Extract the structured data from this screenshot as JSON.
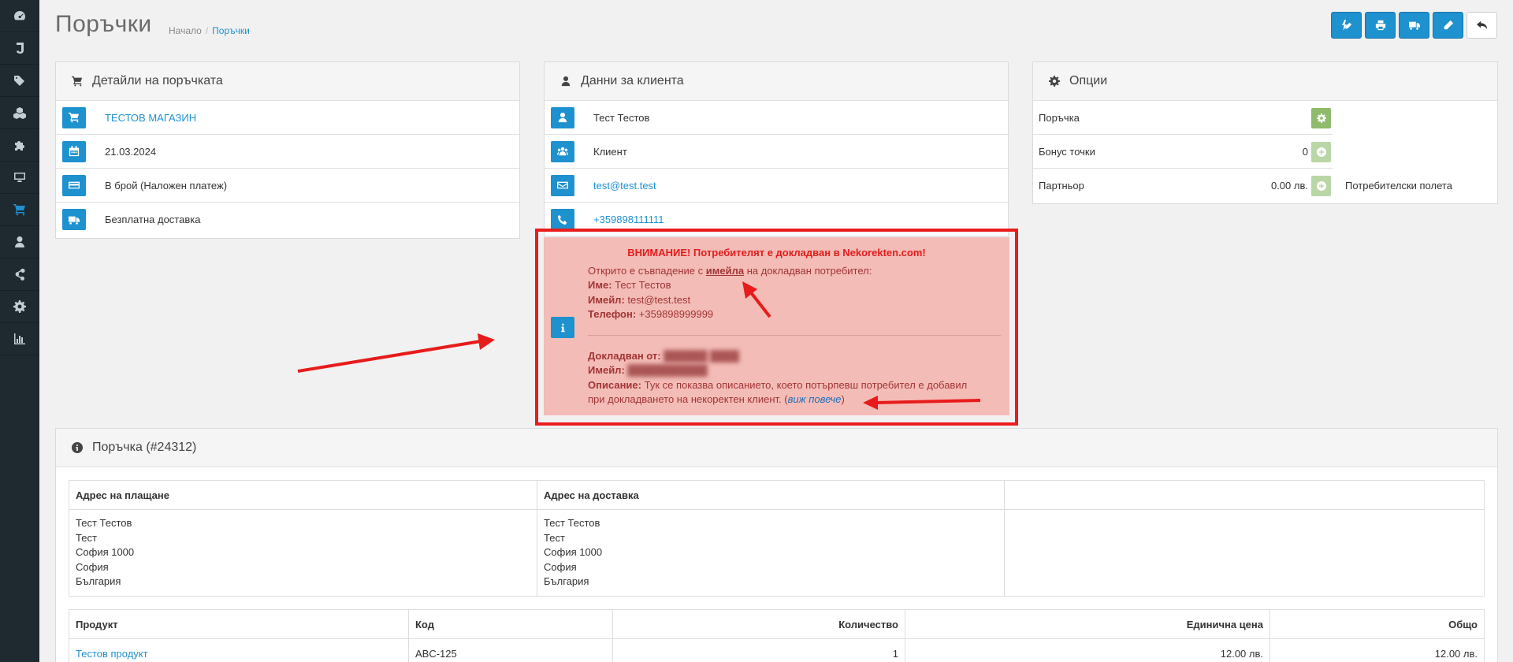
{
  "header": {
    "title": "Поръчки",
    "breadcrumb": [
      "Начало",
      "Поръчки"
    ]
  },
  "sidebar": {
    "items": [
      {
        "icon": "dashboard-icon"
      },
      {
        "icon": "catalog-j-icon"
      },
      {
        "icon": "tags-icon"
      },
      {
        "icon": "cubes-icon"
      },
      {
        "icon": "puzzle-icon"
      },
      {
        "icon": "desktop-icon"
      },
      {
        "icon": "shopping-cart-icon",
        "active": true
      },
      {
        "icon": "user-icon"
      },
      {
        "icon": "share-icon"
      },
      {
        "icon": "cog-icon"
      },
      {
        "icon": "bar-chart-icon"
      }
    ]
  },
  "order_details": {
    "heading": "Детайли на поръчката",
    "store": "ТЕСТОВ МАГАЗИН",
    "date": "21.03.2024",
    "payment": "В брой (Наложен платеж)",
    "shipping": "Безплатна доставка"
  },
  "customer": {
    "heading": "Данни за клиента",
    "name": "Тест Тестов",
    "group": "Клиент",
    "email": "test@test.test",
    "phone": "+359898111111"
  },
  "options": {
    "heading": "Опции",
    "rows": [
      {
        "label": "Поръчка",
        "value": "",
        "extra": ""
      },
      {
        "label": "Бонус точки",
        "value": "0",
        "extra": ""
      },
      {
        "label": "Партньор",
        "value": "0.00 лв.",
        "extra": "Потребителски полета"
      }
    ]
  },
  "alert": {
    "title": "ВНИМАНИЕ! Потребителят е докладван в Nekorekten.com!",
    "match_prefix": "Открито е съвпадение с",
    "match_field": "имейла",
    "match_suffix": "на докладван потребител:",
    "name_label": "Име:",
    "name_value": "Тест Тестов",
    "email_label": "Имейл:",
    "email_value": "test@test.test",
    "phone_label": "Телефон:",
    "phone_value": "+359898999999",
    "reported_by_label": "Докладван от:",
    "reporter_email_label": "Имейл:",
    "description_label": "Описание:",
    "description_line1": "Тук се показва описанието, което потърпевш потребител е добавил",
    "description_line2": "при докладването на некоректен клиент.",
    "more_link": "виж повече"
  },
  "order": {
    "heading": "Поръчка (#24312)",
    "address_headers": [
      "Адрес на плащане",
      "Адрес на доставка",
      ""
    ],
    "payment_address": [
      "Тест Тестов",
      "Тест",
      "София 1000",
      "София",
      "България"
    ],
    "shipping_address": [
      "Тест Тестов",
      "Тест",
      "София 1000",
      "София",
      "България"
    ],
    "product_headers": [
      "Продукт",
      "Код",
      "Количество",
      "Единична цена",
      "Общо"
    ],
    "products": [
      {
        "name": "Тестов продукт",
        "code": "ABC-125",
        "qty": "1",
        "price": "12.00 лв.",
        "total": "12.00 лв."
      }
    ]
  },
  "colors": {
    "primary": "#1e91cf",
    "sidebar": "#1e2930",
    "success": "#8fbb6c",
    "alert_bg": "#f4bcb7",
    "alert_frame": "#ea1c1c"
  }
}
